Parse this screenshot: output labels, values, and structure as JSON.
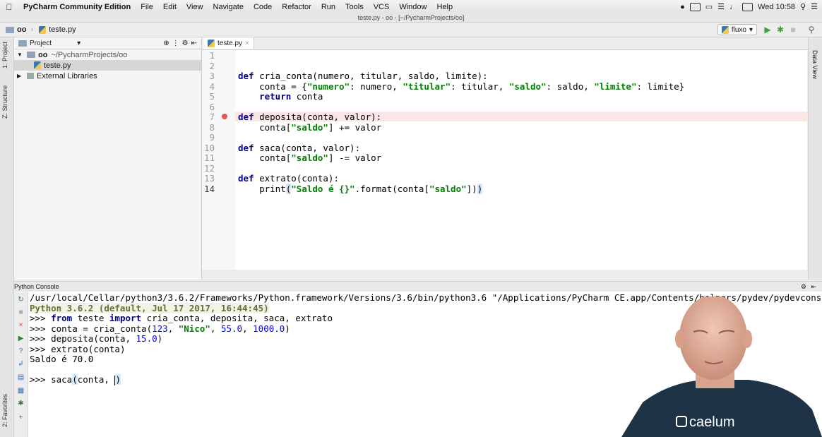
{
  "menubar": {
    "app_name": "PyCharm Community Edition",
    "items": [
      "File",
      "Edit",
      "View",
      "Navigate",
      "Code",
      "Refactor",
      "Run",
      "Tools",
      "VCS",
      "Window",
      "Help"
    ],
    "clock": "Wed 10:58"
  },
  "window_title": "teste.py - oo - [~/PycharmProjects/oo]",
  "navbar": {
    "crumbs": [
      "oo",
      "teste.py"
    ],
    "run_config": "fluxo"
  },
  "left_tabs": [
    "1: Project",
    "Z: Structure",
    "2: Favorites"
  ],
  "right_tabs": [
    "Data View"
  ],
  "project": {
    "header": "Project",
    "root_name": "oo",
    "root_path": "~/PycharmProjects/oo",
    "file": "teste.py",
    "libraries": "External Libraries"
  },
  "editor": {
    "tab": "teste.py",
    "line_numbers": [
      "1",
      "2",
      "3",
      "4",
      "5",
      "6",
      "7",
      "8",
      "9",
      "10",
      "11",
      "12",
      "13",
      "14"
    ],
    "lines": {
      "l3": {
        "kw": "def",
        "rest": " cria_conta(numero, titular, saldo, limite):"
      },
      "l4": {
        "a": "    conta = {",
        "s1": "\"numero\"",
        "b": ": numero, ",
        "s2": "\"titular\"",
        "c": ": titular, ",
        "s3": "\"saldo\"",
        "d": ": saldo, ",
        "s4": "\"limite\"",
        "e": ": limite}"
      },
      "l5": {
        "indent": "    ",
        "kw": "return",
        "rest": " conta"
      },
      "l7": {
        "kw": "def",
        "rest": " deposita(conta, valor):"
      },
      "l8": {
        "a": "    conta[",
        "s": "\"saldo\"",
        "b": "] += valor"
      },
      "l10": {
        "kw": "def",
        "rest": " saca(conta, valor):"
      },
      "l11": {
        "a": "    conta[",
        "s": "\"saldo\"",
        "b": "] -= valor"
      },
      "l13": {
        "kw": "def",
        "rest": " extrato(conta):"
      },
      "l14": {
        "a": "    print",
        "p1": "(",
        "s1": "\"Saldo é {}\"",
        "b": ".format(conta[",
        "s2": "\"saldo\"",
        "c": "])",
        "p2": ")"
      }
    }
  },
  "console": {
    "title": "Python Console",
    "cmd": "/usr/local/Cellar/python3/3.6.2/Frameworks/Python.framework/Versions/3.6/bin/python3.6 \"/Applications/PyCharm CE.app/Contents/helpers/pydev/pydevconsole.",
    "banner": "Python 3.6.2 (default, Jul 17 2017, 16:44:45)",
    "prompt": ">>> ",
    "l1": {
      "kw1": "from",
      "a": " teste ",
      "kw2": "import",
      "b": " cria_conta, deposita, saca, extrato"
    },
    "l2": {
      "a": "conta = cria_conta(",
      "n1": "123",
      "b": ", ",
      "s": "\"Nico\"",
      "c": ", ",
      "n2": "55.0",
      "d": ", ",
      "n3": "1000.0",
      "e": ")"
    },
    "l3": {
      "a": "deposita(conta, ",
      "n": "15.0",
      "b": ")"
    },
    "l4": "extrato(conta)",
    "output": "Saldo é 70.0",
    "l5": {
      "a": "saca",
      "p1": "(",
      "b": "conta, ",
      "p2": ")"
    }
  },
  "webcam_brand": "caelum"
}
